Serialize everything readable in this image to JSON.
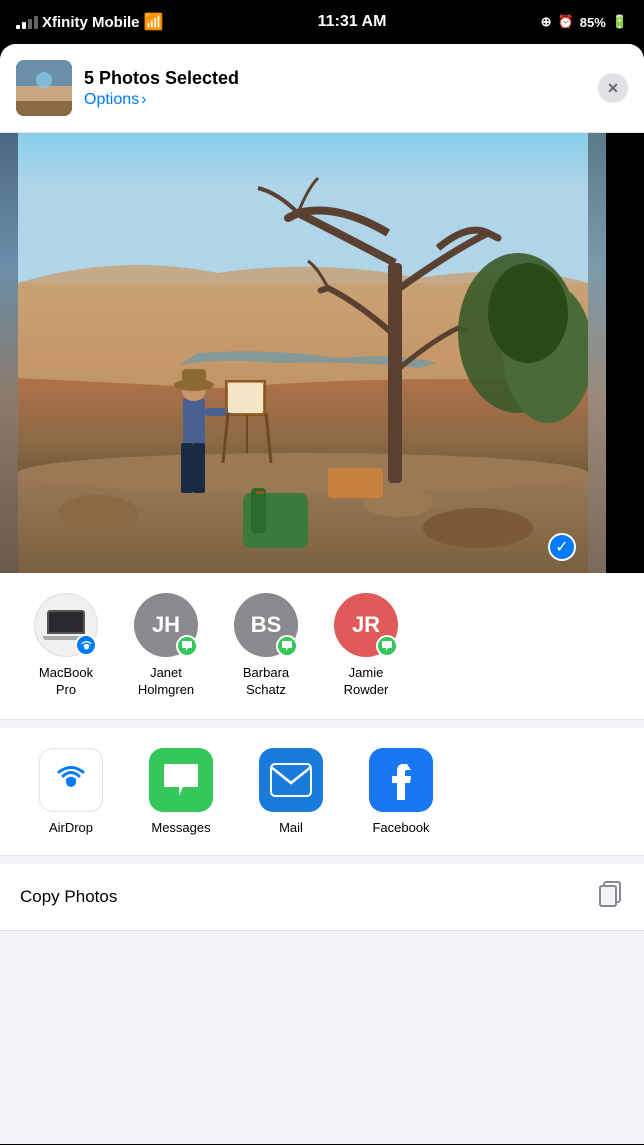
{
  "statusBar": {
    "carrier": "Xfinity Mobile",
    "time": "11:31 AM",
    "battery": "85%"
  },
  "shareHeader": {
    "title": "5 Photos Selected",
    "options": "Options",
    "closeLabel": "✕"
  },
  "people": [
    {
      "id": "macbook",
      "initials": "",
      "name": "MacBook\nPro",
      "color": "light",
      "badge": "airdrop"
    },
    {
      "id": "jh",
      "initials": "JH",
      "name": "Janet\nHolmgren",
      "color": "gray",
      "badge": "message"
    },
    {
      "id": "bs",
      "initials": "BS",
      "name": "Barbara\nSchatz",
      "color": "gray",
      "badge": "message"
    },
    {
      "id": "jr",
      "initials": "JR",
      "name": "Jamie\nRowder",
      "color": "red",
      "badge": "message"
    }
  ],
  "apps": [
    {
      "id": "airdrop",
      "label": "AirDrop",
      "icon": "airdrop"
    },
    {
      "id": "messages",
      "label": "Messages",
      "icon": "messages"
    },
    {
      "id": "mail",
      "label": "Mail",
      "icon": "mail"
    },
    {
      "id": "facebook",
      "label": "Facebook",
      "icon": "facebook"
    }
  ],
  "actions": [
    {
      "id": "copy-photos",
      "label": "Copy Photos",
      "icon": "copy"
    }
  ]
}
